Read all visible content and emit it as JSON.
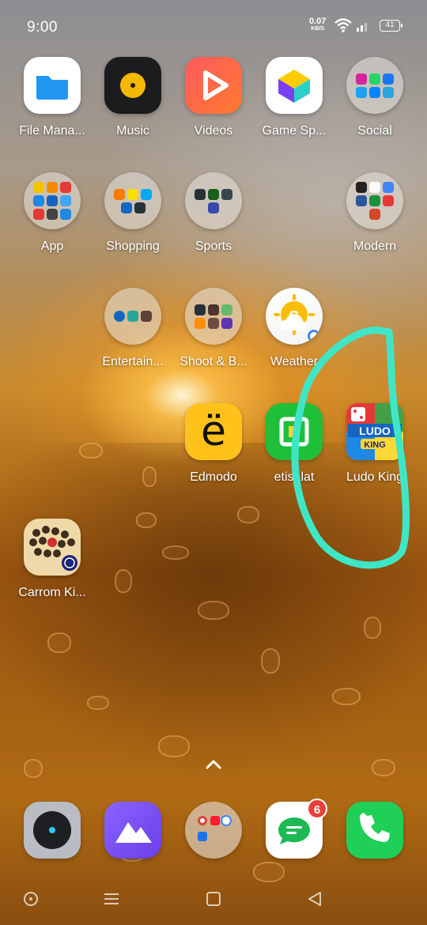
{
  "status_bar": {
    "time": "9:00",
    "net_speed": "0.07",
    "net_unit": "KB/S",
    "battery": "41"
  },
  "apps": {
    "file_manager": "File Mana...",
    "music": "Music",
    "videos": "Videos",
    "game_space": "Game Sp...",
    "social": "Social",
    "app_folder": "App",
    "shopping": "Shopping",
    "sports": "Sports",
    "modern": "Modern",
    "entertainment": "Entertain...",
    "shoot_b": "Shoot & B...",
    "weather": "Weather",
    "edmodo": "Edmodo",
    "etisalat": "etisalat",
    "ludo_king": "Ludo King",
    "carrom_king": "Carrom Ki..."
  },
  "dock": {
    "messages_badge": "6"
  },
  "icons": {
    "edmodo_glyph": "ë",
    "weather_glyph": "G",
    "ludo_text": "LUDO",
    "ludo_sub": "KING"
  },
  "colors": {
    "annotation": "#3fe6c6",
    "badge": "#e8403a"
  }
}
